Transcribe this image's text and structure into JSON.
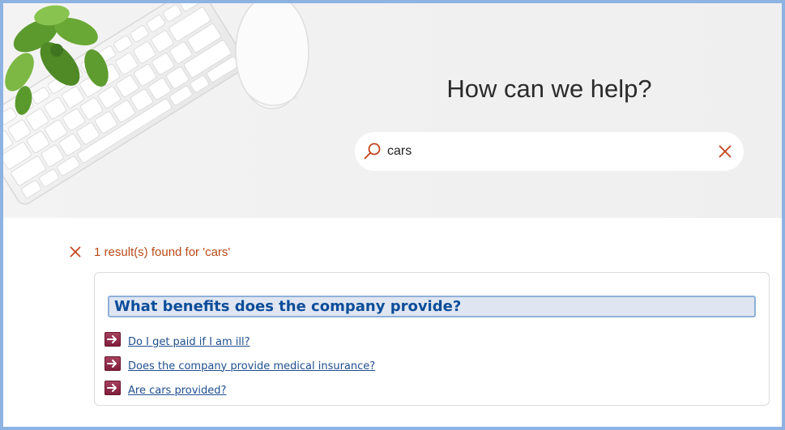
{
  "hero": {
    "title": "How can we help?"
  },
  "search": {
    "value": "cars",
    "icon": "search-icon",
    "clear_icon": "close-icon"
  },
  "results": {
    "summary": "1 result(s) found for 'cars'",
    "close_icon": "close-icon"
  },
  "faq_group": {
    "title": "What benefits does the company provide?",
    "items": [
      {
        "label": "Do I get paid if I am ill?",
        "icon": "arrow-right-icon"
      },
      {
        "label": "Does the company provide medical insurance?",
        "icon": "arrow-right-icon"
      },
      {
        "label": "Are cars provided?",
        "icon": "arrow-right-icon"
      }
    ]
  },
  "colors": {
    "accent": "#b94a16",
    "title_blue": "#0c4d9a",
    "link": "#1f4f8f",
    "frame": "#8eb3e3",
    "arrow": "#8a2545"
  }
}
